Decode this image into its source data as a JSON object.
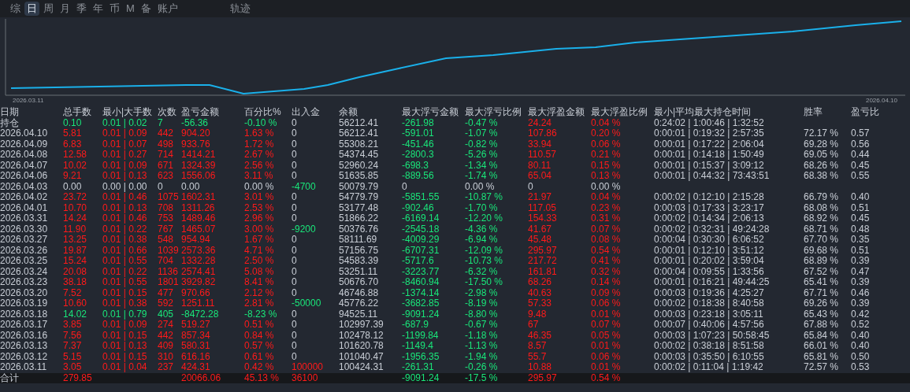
{
  "tabs": [
    {
      "label": "综",
      "selected": false
    },
    {
      "label": "日",
      "selected": true
    },
    {
      "label": "周",
      "selected": false
    },
    {
      "label": "月",
      "selected": false
    },
    {
      "label": "季",
      "selected": false
    },
    {
      "label": "年",
      "selected": false
    },
    {
      "label": "币",
      "selected": false
    },
    {
      "label": "M",
      "selected": false
    },
    {
      "label": "备",
      "selected": false
    },
    {
      "label": "账户",
      "selected": false
    }
  ],
  "track_tab": {
    "label": "轨迹",
    "selected": false
  },
  "chart": {
    "start_label": "2026.03.11",
    "end_label": "2026.04.10"
  },
  "table": {
    "columns": [
      "日期",
      "总手数",
      "最小|大手数",
      "次数",
      "盈亏金额",
      "百分比%",
      "出入金",
      "余额",
      "最大浮亏金额",
      "最大浮亏比例",
      "最大浮盈金额",
      "最大浮盈比例",
      "最小|平均最大持仓时间",
      "胜率",
      "盈亏比"
    ],
    "rows": [
      {
        "kind": "loss",
        "deposit": false,
        "withdrawal": false,
        "cells": [
          "持仓",
          "0.10",
          "0.01 | 0.02",
          "7",
          "-56.36",
          "-0.10 %",
          "0",
          "56212.41",
          "-261.98",
          "-0.47 %",
          "24.24",
          "0.04 %",
          "0:24:02 | 1:00:46 | 1:32:52"
        ]
      },
      {
        "kind": "profit",
        "deposit": false,
        "withdrawal": false,
        "cells": [
          "2026.04.10",
          "5.81",
          "0.01 | 0.09",
          "442",
          "904.20",
          "1.63 %",
          "0",
          "56212.41",
          "-591.01",
          "-1.07 %",
          "107.86",
          "0.20 %",
          "0:00:01 | 0:19:32 | 2:57:35",
          "72.17 %",
          "0.57"
        ]
      },
      {
        "kind": "profit",
        "deposit": false,
        "withdrawal": false,
        "cells": [
          "2026.04.09",
          "6.83",
          "0.01 | 0.07",
          "498",
          "933.76",
          "1.72 %",
          "0",
          "55308.21",
          "-451.46",
          "-0.82 %",
          "33.94",
          "0.06 %",
          "0:00:01 | 0:17:22 | 2:06:04",
          "69.28 %",
          "0.56"
        ]
      },
      {
        "kind": "profit",
        "deposit": false,
        "withdrawal": false,
        "cells": [
          "2026.04.08",
          "12.58",
          "0.01 | 0.27",
          "714",
          "1414.21",
          "2.67 %",
          "0",
          "54374.45",
          "-2800.3",
          "-5.26 %",
          "110.57",
          "0.21 %",
          "0:00:01 | 0:14:18 | 1:50:49",
          "69.05 %",
          "0.44"
        ]
      },
      {
        "kind": "profit",
        "deposit": false,
        "withdrawal": false,
        "cells": [
          "2026.04.07",
          "10.02",
          "0.01 | 0.09",
          "671",
          "1324.39",
          "2.56 %",
          "0",
          "52960.24",
          "-698.3",
          "-1.34 %",
          "80.11",
          "0.15 %",
          "0:00:01 | 0:15:37 | 3:09:12",
          "68.26 %",
          "0.45"
        ]
      },
      {
        "kind": "profit",
        "deposit": false,
        "withdrawal": false,
        "cells": [
          "2026.04.06",
          "9.21",
          "0.01 | 0.13",
          "623",
          "1556.06",
          "3.11 %",
          "0",
          "51635.85",
          "-889.56",
          "-1.74 %",
          "65.04",
          "0.13 %",
          "0:00:01 | 0:44:32 | 73:43:51",
          "68.38 %",
          "0.55"
        ]
      },
      {
        "kind": "flat",
        "deposit": false,
        "withdrawal": true,
        "cells": [
          "2026.04.03",
          "0.00",
          "0.00 | 0.00",
          "0",
          "0.00",
          "0.00 %",
          "-4700",
          "50079.79",
          "0",
          "0.00 %",
          "0",
          "0.00 %"
        ]
      },
      {
        "kind": "profit",
        "deposit": false,
        "withdrawal": false,
        "cells": [
          "2026.04.02",
          "23.72",
          "0.01 | 0.46",
          "1075",
          "1602.31",
          "3.01 %",
          "0",
          "54779.79",
          "-5851.55",
          "-10.87 %",
          "21.97",
          "0.04 %",
          "0:00:02 | 0:12:10 | 2:15:28",
          "66.79 %",
          "0.40"
        ]
      },
      {
        "kind": "profit",
        "deposit": false,
        "withdrawal": false,
        "cells": [
          "2026.04.01",
          "10.70",
          "0.01 | 0.13",
          "708",
          "1311.26",
          "2.53 %",
          "0",
          "53177.48",
          "-902.46",
          "-1.70 %",
          "117.05",
          "0.23 %",
          "0:00:03 | 0:17:33 | 3:23:17",
          "68.08 %",
          "0.51"
        ]
      },
      {
        "kind": "profit",
        "deposit": false,
        "withdrawal": false,
        "cells": [
          "2026.03.31",
          "14.24",
          "0.01 | 0.46",
          "753",
          "1489.46",
          "2.96 %",
          "0",
          "51866.22",
          "-6169.14",
          "-12.20 %",
          "154.33",
          "0.31 %",
          "0:00:02 | 0:14:34 | 2:06:13",
          "68.92 %",
          "0.45"
        ]
      },
      {
        "kind": "profit",
        "deposit": false,
        "withdrawal": true,
        "cells": [
          "2026.03.30",
          "11.90",
          "0.01 | 0.22",
          "767",
          "1465.07",
          "3.00 %",
          "-9200",
          "50376.76",
          "-2545.18",
          "-4.36 %",
          "41.67",
          "0.07 %",
          "0:00:02 | 0:32:31 | 49:24:28",
          "68.71 %",
          "0.48"
        ]
      },
      {
        "kind": "profit",
        "deposit": false,
        "withdrawal": false,
        "cells": [
          "2026.03.27",
          "13.25",
          "0.01 | 0.38",
          "548",
          "954.94",
          "1.67 %",
          "0",
          "58111.69",
          "-4009.29",
          "-6.94 %",
          "45.48",
          "0.08 %",
          "0:00:04 | 0:30:30 | 6:06:52",
          "67.70 %",
          "0.35"
        ]
      },
      {
        "kind": "profit",
        "deposit": false,
        "withdrawal": false,
        "cells": [
          "2026.03.26",
          "19.87",
          "0.01 | 0.66",
          "1039",
          "2573.36",
          "4.71 %",
          "0",
          "57156.75",
          "-6707.31",
          "-12.09 %",
          "295.97",
          "0.54 %",
          "0:00:01 | 0:12:10 | 3:51:12",
          "69.68 %",
          "0.51"
        ]
      },
      {
        "kind": "profit",
        "deposit": false,
        "withdrawal": false,
        "cells": [
          "2026.03.25",
          "15.24",
          "0.01 | 0.55",
          "704",
          "1332.28",
          "2.50 %",
          "0",
          "54583.39",
          "-5717.6",
          "-10.73 %",
          "217.72",
          "0.41 %",
          "0:00:01 | 0:20:02 | 3:59:04",
          "68.89 %",
          "0.39"
        ]
      },
      {
        "kind": "profit",
        "deposit": false,
        "withdrawal": false,
        "cells": [
          "2026.03.24",
          "20.08",
          "0.01 | 0.22",
          "1136",
          "2574.41",
          "5.08 %",
          "0",
          "53251.11",
          "-3223.77",
          "-6.32 %",
          "161.81",
          "0.32 %",
          "0:00:04 | 0:09:55 | 1:33:56",
          "67.52 %",
          "0.47"
        ]
      },
      {
        "kind": "profit",
        "deposit": false,
        "withdrawal": false,
        "cells": [
          "2026.03.23",
          "38.18",
          "0.01 | 0.55",
          "1801",
          "3929.82",
          "8.41 %",
          "0",
          "50676.70",
          "-8460.94",
          "-17.50 %",
          "68.26",
          "0.14 %",
          "0:00:01 | 0:16:21 | 49:44:25",
          "65.41 %",
          "0.39"
        ]
      },
      {
        "kind": "profit",
        "deposit": false,
        "withdrawal": false,
        "cells": [
          "2026.03.20",
          "7.52",
          "0.01 | 0.15",
          "477",
          "970.66",
          "2.12 %",
          "0",
          "46746.88",
          "-1374.14",
          "-2.98 %",
          "40.63",
          "0.09 %",
          "0:00:03 | 0:19:36 | 4:25:27",
          "67.71 %",
          "0.46"
        ]
      },
      {
        "kind": "profit",
        "deposit": false,
        "withdrawal": true,
        "cells": [
          "2026.03.19",
          "10.60",
          "0.01 | 0.38",
          "592",
          "1251.11",
          "2.81 %",
          "-50000",
          "45776.22",
          "-3682.85",
          "-8.19 %",
          "57.33",
          "0.06 %",
          "0:00:02 | 0:18:38 | 8:40:58",
          "69.26 %",
          "0.39"
        ]
      },
      {
        "kind": "loss",
        "deposit": false,
        "withdrawal": false,
        "cells": [
          "2026.03.18",
          "14.02",
          "0.01 | 0.79",
          "405",
          "-8472.28",
          "-8.23 %",
          "0",
          "94525.11",
          "-9091.24",
          "-8.80 %",
          "9.48",
          "0.01 %",
          "0:00:03 | 0:23:18 | 3:05:11",
          "65.43 %",
          "0.42"
        ]
      },
      {
        "kind": "profit",
        "deposit": false,
        "withdrawal": false,
        "cells": [
          "2026.03.17",
          "3.85",
          "0.01 | 0.09",
          "274",
          "519.27",
          "0.51 %",
          "0",
          "102997.39",
          "-687.9",
          "-0.67 %",
          "67",
          "0.07 %",
          "0:00:07 | 0:40:06 | 4:57:56",
          "67.88 %",
          "0.52"
        ]
      },
      {
        "kind": "profit",
        "deposit": false,
        "withdrawal": false,
        "cells": [
          "2026.03.16",
          "7.56",
          "0.01 | 0.15",
          "442",
          "857.34",
          "0.84 %",
          "0",
          "102478.12",
          "-1199.84",
          "-1.18 %",
          "46.35",
          "0.05 %",
          "0:00:03 | 1:07:23 | 50:58:45",
          "65.84 %",
          "0.40"
        ]
      },
      {
        "kind": "profit",
        "deposit": false,
        "withdrawal": false,
        "cells": [
          "2026.03.13",
          "7.37",
          "0.01 | 0.13",
          "409",
          "580.31",
          "0.57 %",
          "0",
          "101620.78",
          "-1149.4",
          "-1.13 %",
          "8.57",
          "0.01 %",
          "0:00:02 | 0:38:18 | 8:51:58",
          "66.01 %",
          "0.40"
        ]
      },
      {
        "kind": "profit",
        "deposit": false,
        "withdrawal": false,
        "cells": [
          "2026.03.12",
          "5.15",
          "0.01 | 0.15",
          "310",
          "616.16",
          "0.61 %",
          "0",
          "101040.47",
          "-1956.35",
          "-1.94 %",
          "55.7",
          "0.06 %",
          "0:00:03 | 0:35:50 | 6:10:55",
          "65.81 %",
          "0.50"
        ]
      },
      {
        "kind": "profit",
        "deposit": true,
        "withdrawal": false,
        "cells": [
          "2026.03.11",
          "3.05",
          "0.01 | 0.04",
          "237",
          "424.31",
          "0.42 %",
          "100000",
          "100424.31",
          "-261.31",
          "-0.26 %",
          "10.88",
          "0.01 %",
          "0:00:02 | 0:11:04 | 1:19:42",
          "72.57 %",
          "0.53"
        ]
      }
    ],
    "total": {
      "label": "合计",
      "lots": "279.85",
      "profit": "20066.06",
      "percent": "45.13 %",
      "flow": "36100",
      "float_loss": "-9091.24",
      "float_loss_pct": "-17.5 %",
      "float_profit": "295.97",
      "float_profit_pct": "0.54 %"
    }
  }
}
